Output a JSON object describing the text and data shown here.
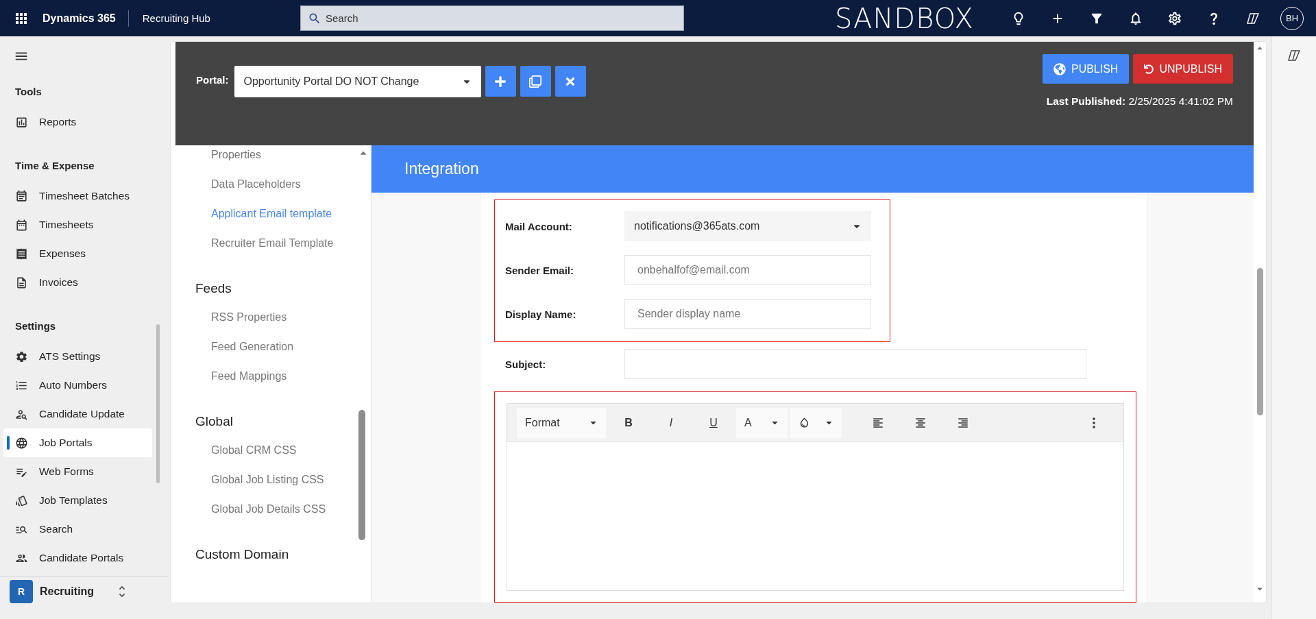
{
  "top_bar": {
    "app_name": "Dynamics 365",
    "area_name": "Recruiting Hub",
    "search_placeholder": "Search",
    "environment_label": "SANDBOX",
    "avatar_initials": "BH"
  },
  "sidebar": {
    "sections": [
      {
        "title": "Tools",
        "items": [
          {
            "label": "Reports",
            "selected": false
          }
        ]
      },
      {
        "title": "Time & Expense",
        "items": [
          {
            "label": "Timesheet Batches",
            "selected": false
          },
          {
            "label": "Timesheets",
            "selected": false
          },
          {
            "label": "Expenses",
            "selected": false
          },
          {
            "label": "Invoices",
            "selected": false
          }
        ]
      },
      {
        "title": "Settings",
        "items": [
          {
            "label": "ATS Settings",
            "selected": false
          },
          {
            "label": "Auto Numbers",
            "selected": false
          },
          {
            "label": "Candidate Update",
            "selected": false
          },
          {
            "label": "Job Portals",
            "selected": true
          },
          {
            "label": "Web Forms",
            "selected": false
          },
          {
            "label": "Job Templates",
            "selected": false
          },
          {
            "label": "Search",
            "selected": false
          },
          {
            "label": "Candidate Portals",
            "selected": false
          }
        ]
      }
    ],
    "area_switcher": {
      "badge": "R",
      "label": "Recruiting"
    }
  },
  "portal_header": {
    "portal_label": "Portal:",
    "portal_value": "Opportunity Portal DO NOT Change",
    "publish_label": "PUBLISH",
    "unpublish_label": "UNPUBLISH",
    "last_published_label": "Last Published:",
    "last_published_value": "2/25/2025 4:41:02 PM"
  },
  "settings_nav": {
    "groups": [
      {
        "items": [
          {
            "label": "Properties",
            "selected": false
          },
          {
            "label": "Data Placeholders",
            "selected": false
          },
          {
            "label": "Applicant Email template",
            "selected": true
          },
          {
            "label": "Recruiter Email Template",
            "selected": false
          }
        ]
      },
      {
        "title": "Feeds",
        "items": [
          {
            "label": "RSS Properties",
            "selected": false
          },
          {
            "label": "Feed Generation",
            "selected": false
          },
          {
            "label": "Feed Mappings",
            "selected": false
          }
        ]
      },
      {
        "title": "Global",
        "items": [
          {
            "label": "Global CRM CSS",
            "selected": false
          },
          {
            "label": "Global Job Listing CSS",
            "selected": false
          },
          {
            "label": "Global Job Details CSS",
            "selected": false
          }
        ]
      },
      {
        "title": "Custom Domain"
      }
    ]
  },
  "section_title": "Integration",
  "form": {
    "highlighted_fields": [
      {
        "kind": "select",
        "label": "Mail Account:",
        "value": "notifications@365ats.com"
      },
      {
        "kind": "input",
        "label": "Sender Email:",
        "placeholder": "onbehalfof@email.com"
      },
      {
        "kind": "input",
        "label": "Display Name:",
        "placeholder": "Sender display name"
      }
    ],
    "subject": {
      "label": "Subject:"
    },
    "editor_toolbar": [
      {
        "kind": "dropdown",
        "label": "Format"
      },
      {
        "kind": "text",
        "label": "B"
      },
      {
        "kind": "text",
        "label": "I"
      },
      {
        "kind": "text",
        "label": "U"
      },
      {
        "kind": "color",
        "label": "A"
      },
      {
        "kind": "fill"
      },
      {
        "kind": "align-left"
      },
      {
        "kind": "align-center"
      },
      {
        "kind": "align-right"
      },
      {
        "kind": "more"
      }
    ]
  }
}
